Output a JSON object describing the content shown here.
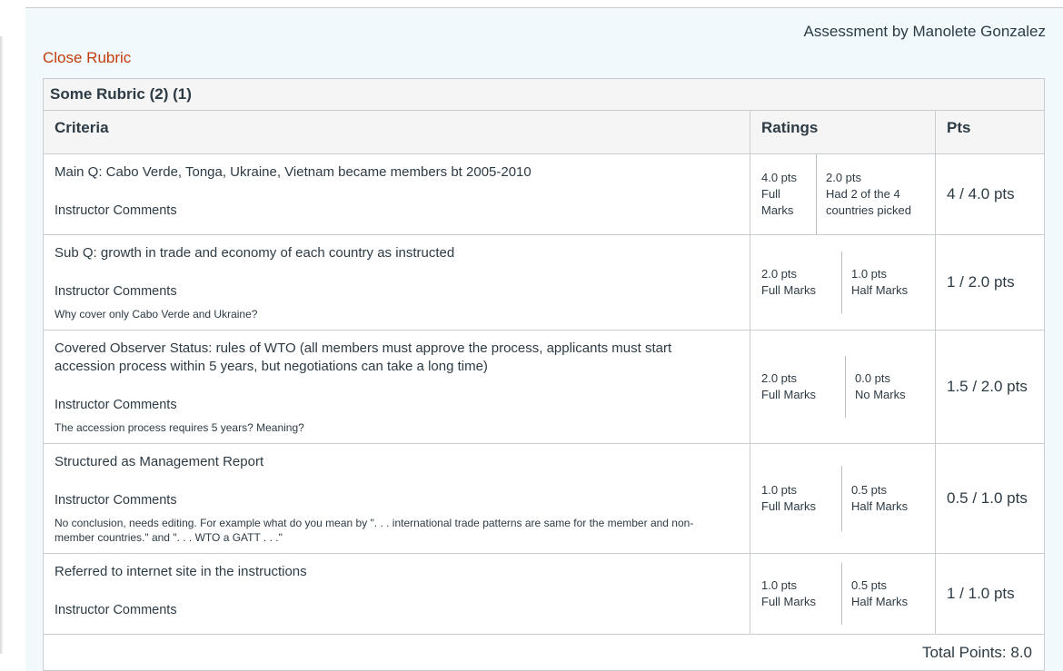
{
  "header": {
    "assessor": "Assessment by Manolete Gonzalez",
    "close_label": "Close Rubric"
  },
  "rubric": {
    "title": "Some Rubric (2) (1)",
    "columns": {
      "criteria": "Criteria",
      "ratings": "Ratings",
      "pts": "Pts"
    },
    "rows": [
      {
        "description": "Main Q: Cabo Verde, Tonga, Ukraine, Vietnam became members bt 2005-2010",
        "comments_label": "Instructor Comments",
        "comment": "",
        "ratings": [
          {
            "points": "4.0 pts",
            "label": "Full Marks"
          },
          {
            "points": "2.0 pts",
            "label": "Had 2 of the 4 countries picked"
          }
        ],
        "score": "4 / 4.0 pts"
      },
      {
        "description": "Sub Q: growth in trade and economy of each country as instructed",
        "comments_label": "Instructor Comments",
        "comment": "Why cover only Cabo Verde and Ukraine?",
        "ratings": [
          {
            "points": "2.0 pts",
            "label": "Full Marks"
          },
          {
            "points": "1.0 pts",
            "label": "Half Marks"
          }
        ],
        "score": "1 / 2.0 pts"
      },
      {
        "description": "Covered Observer Status: rules of WTO (all members must approve the process, applicants must start accession process within 5 years, but negotiations can take a long time)",
        "comments_label": "Instructor Comments",
        "comment": "The accession process requires 5 years? Meaning?",
        "ratings": [
          {
            "points": "2.0 pts",
            "label": "Full Marks"
          },
          {
            "points": "0.0 pts",
            "label": "No Marks"
          }
        ],
        "score": "1.5 / 2.0 pts"
      },
      {
        "description": "Structured as Management Report",
        "comments_label": "Instructor Comments",
        "comment": "No conclusion, needs editing. For example what do you mean by \". . . international trade patterns are same for the member and non-member countries.\" and \". . . WTO a GATT . . .\"",
        "ratings": [
          {
            "points": "1.0 pts",
            "label": "Full Marks"
          },
          {
            "points": "0.5 pts",
            "label": "Half Marks"
          }
        ],
        "score": "0.5 / 1.0 pts"
      },
      {
        "description": "Referred to internet site in the instructions",
        "comments_label": "Instructor Comments",
        "comment": "",
        "ratings": [
          {
            "points": "1.0 pts",
            "label": "Full Marks"
          },
          {
            "points": "0.5 pts",
            "label": "Half Marks"
          }
        ],
        "score": "1 / 1.0 pts"
      }
    ],
    "total": "Total Points: 8.0"
  },
  "colors": {
    "link": "#c23c0d",
    "panel": "#f1f9fc",
    "border": "#c7cdd1",
    "header_bg": "#f5f5f5",
    "text": "#2d3b45"
  }
}
